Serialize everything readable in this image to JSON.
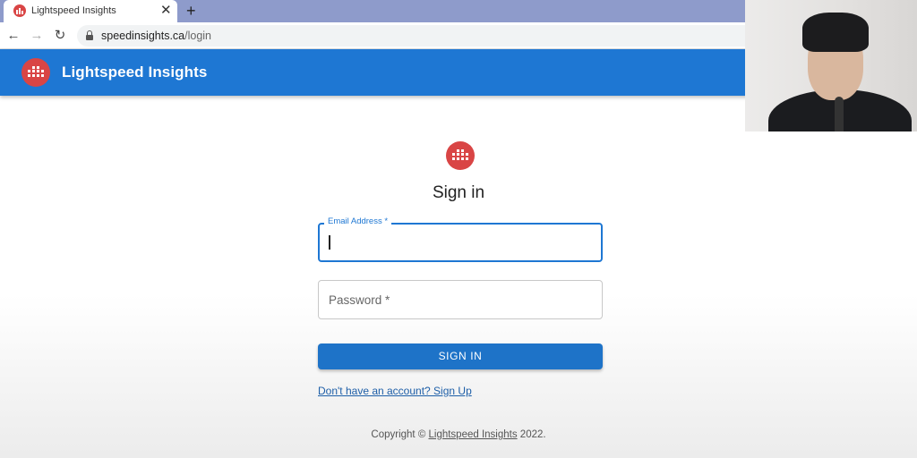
{
  "browser": {
    "tab_title": "Lightspeed Insights",
    "tab_close": "✕",
    "new_tab": "+",
    "url_host": "speedinsights.ca",
    "url_path": "/login",
    "back": "←",
    "forward": "→",
    "reload": "↻"
  },
  "appbar": {
    "title": "Lightspeed Insights"
  },
  "login": {
    "title": "Sign in",
    "email_label": "Email Address *",
    "password_placeholder": "Password *",
    "submit_label": "SIGN IN",
    "signup_link": "Don't have an account? Sign Up"
  },
  "footer": {
    "prefix": "Copyright © ",
    "link": "Lightspeed Insights",
    "suffix": " 2022."
  },
  "colors": {
    "brand_blue": "#1e77d3",
    "logo_red": "#d94545",
    "tab_strip": "#8e9bcb"
  },
  "icons": {
    "logo": "bar-grid-icon",
    "lock": "lock-icon"
  }
}
